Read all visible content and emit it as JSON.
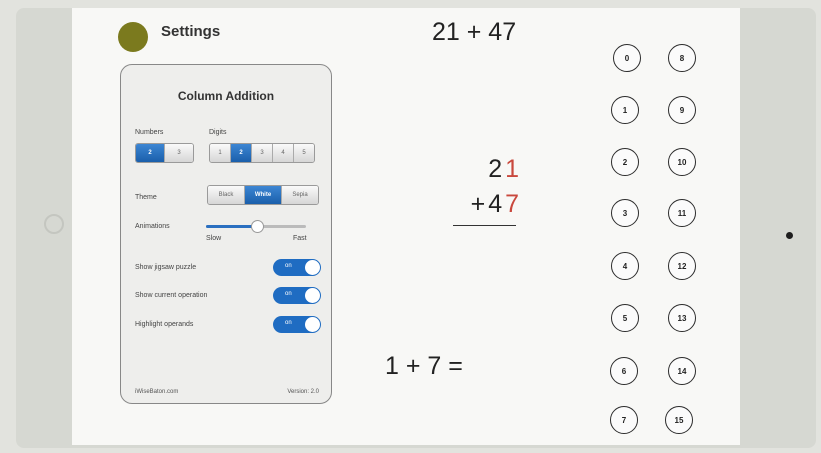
{
  "header": {
    "settings_label": "Settings"
  },
  "panel": {
    "title": "Column Addition",
    "numbers": {
      "label": "Numbers",
      "options": [
        "2",
        "3"
      ],
      "selected": "2"
    },
    "digits": {
      "label": "Digits",
      "options": [
        "1",
        "2",
        "3",
        "4",
        "5"
      ],
      "selected": "2"
    },
    "theme": {
      "label": "Theme",
      "options": [
        "Black",
        "White",
        "Sepia"
      ],
      "selected": "White"
    },
    "animations": {
      "label": "Animations",
      "min_label": "Slow",
      "max_label": "Fast",
      "level": 0.5
    },
    "toggles": [
      {
        "label": "Show jigsaw puzzle",
        "state": "on"
      },
      {
        "label": "Show current operation",
        "state": "on"
      },
      {
        "label": "Highlight operands",
        "state": "on"
      }
    ],
    "footer_left": "iWiseBaton.com",
    "footer_right": "Version: 2.0"
  },
  "problem": {
    "top": "21 + 47",
    "row1": {
      "tens": "2",
      "ones": "1"
    },
    "row2": {
      "plus": "+",
      "tens": "4",
      "ones": "7"
    },
    "current_operation": "1 + 7 ="
  },
  "answers": [
    "0",
    "8",
    "1",
    "9",
    "2",
    "10",
    "3",
    "11",
    "4",
    "12",
    "5",
    "13",
    "6",
    "14",
    "7",
    "15"
  ],
  "colors": {
    "accent": "#1f6cc2",
    "highlight_digit": "#c9483d",
    "settings_dot": "#7b7a1e"
  }
}
